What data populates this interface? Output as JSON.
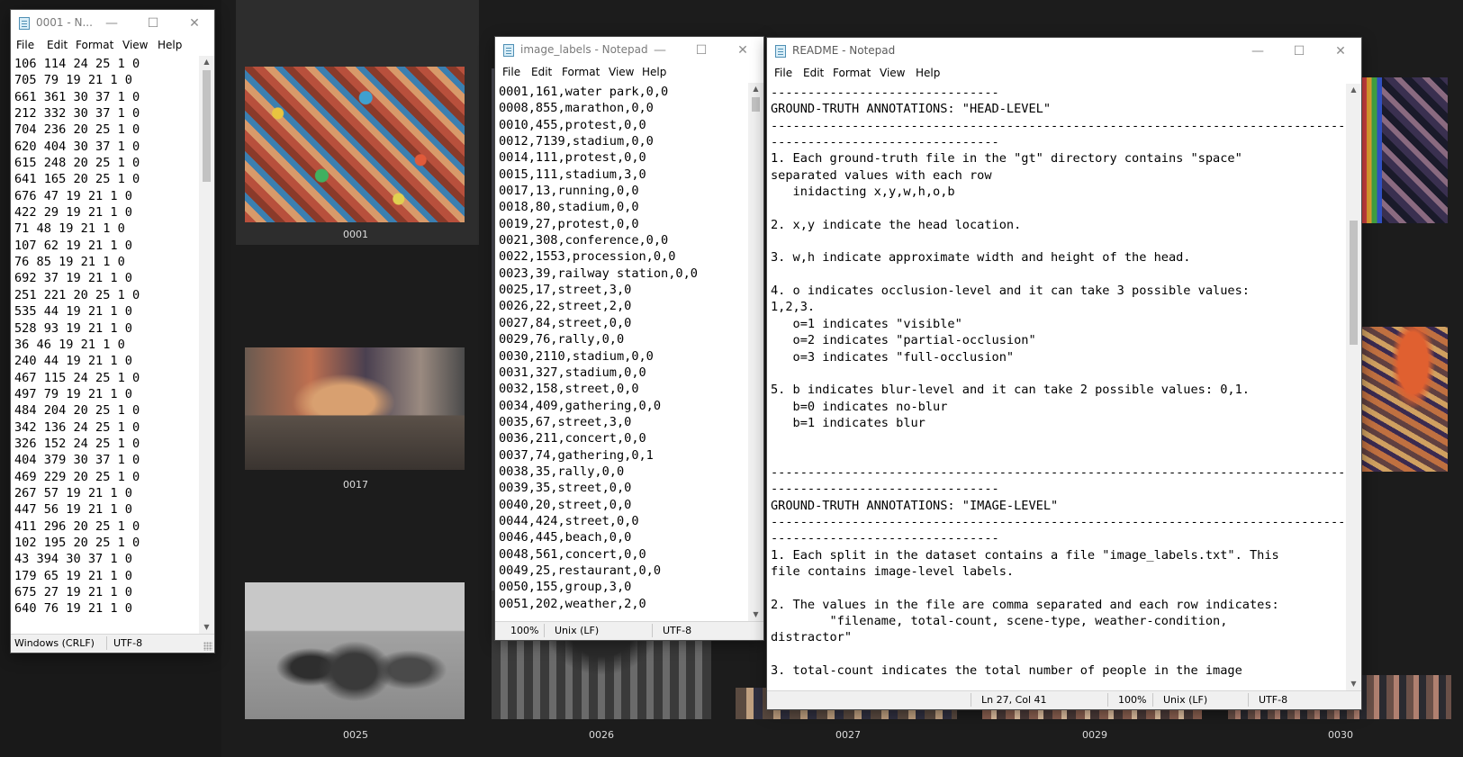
{
  "gallery": {
    "captions": [
      "0001",
      "0017",
      "0025",
      "0026",
      "0027",
      "0029",
      "0030"
    ]
  },
  "colors": {
    "desktop_bg": "#1c1c1c",
    "selected_thumb_bg": "#2d2d2d",
    "window_bg": "#ffffff",
    "statusbar_bg": "#f0f0f0"
  },
  "windows": {
    "gt_file": {
      "title": "0001 - N...",
      "menu": [
        "File",
        "Edit",
        "Format",
        "View",
        "Help"
      ],
      "lines": [
        "106 114 24 25 1 0",
        "705 79 19 21 1 0",
        "661 361 30 37 1 0",
        "212 332 30 37 1 0",
        "704 236 20 25 1 0",
        "620 404 30 37 1 0",
        "615 248 20 25 1 0",
        "641 165 20 25 1 0",
        "676 47 19 21 1 0",
        "422 29 19 21 1 0",
        "71 48 19 21 1 0",
        "107 62 19 21 1 0",
        "76 85 19 21 1 0",
        "692 37 19 21 1 0",
        "251 221 20 25 1 0",
        "535 44 19 21 1 0",
        "528 93 19 21 1 0",
        "36 46 19 21 1 0",
        "240 44 19 21 1 0",
        "467 115 24 25 1 0",
        "497 79 19 21 1 0",
        "484 204 20 25 1 0",
        "342 136 24 25 1 0",
        "326 152 24 25 1 0",
        "404 379 30 37 1 0",
        "469 229 20 25 1 0",
        "267 57 19 21 1 0",
        "447 56 19 21 1 0",
        "411 296 20 25 1 0",
        "102 195 20 25 1 0",
        "43 394 30 37 1 0",
        "179 65 19 21 1 0",
        "675 27 19 21 1 0",
        "640 76 19 21 1 0"
      ],
      "status": {
        "line_ending": "Windows (CRLF)",
        "encoding": "UTF-8"
      }
    },
    "image_labels": {
      "title": "image_labels - Notepad",
      "menu": [
        "File",
        "Edit",
        "Format",
        "View",
        "Help"
      ],
      "lines": [
        "0001,161,water park,0,0",
        "0008,855,marathon,0,0",
        "0010,455,protest,0,0",
        "0012,7139,stadium,0,0",
        "0014,111,protest,0,0",
        "0015,111,stadium,3,0",
        "0017,13,running,0,0",
        "0018,80,stadium,0,0",
        "0019,27,protest,0,0",
        "0021,308,conference,0,0",
        "0022,1553,procession,0,0",
        "0023,39,railway station,0,0",
        "0025,17,street,3,0",
        "0026,22,street,2,0",
        "0027,84,street,0,0",
        "0029,76,rally,0,0",
        "0030,2110,stadium,0,0",
        "0031,327,stadium,0,0",
        "0032,158,street,0,0",
        "0034,409,gathering,0,0",
        "0035,67,street,3,0",
        "0036,211,concert,0,0",
        "0037,74,gathering,0,1",
        "0038,35,rally,0,0",
        "0039,35,street,0,0",
        "0040,20,street,0,0",
        "0044,424,street,0,0",
        "0046,445,beach,0,0",
        "0048,561,concert,0,0",
        "0049,25,restaurant,0,0",
        "0050,155,group,3,0",
        "0051,202,weather,2,0"
      ],
      "status": {
        "zoom": "100%",
        "line_ending": "Unix (LF)",
        "encoding": "UTF-8"
      }
    },
    "readme": {
      "title": "README - Notepad",
      "menu": [
        "File",
        "Edit",
        "Format",
        "View",
        "Help"
      ],
      "lines": [
        "-------------------------------",
        "GROUND-TRUTH ANNOTATIONS: \"HEAD-LEVEL\"",
        "-------------------------------------------------------------------------------",
        "-------------------------------",
        "1. Each ground-truth file in the \"gt\" directory contains \"space\"",
        "separated values with each row",
        "   inidacting x,y,w,h,o,b",
        "",
        "2. x,y indicate the head location.",
        "",
        "3. w,h indicate approximate width and height of the head.",
        "",
        "4. o indicates occlusion-level and it can take 3 possible values:",
        "1,2,3.",
        "   o=1 indicates \"visible\"",
        "   o=2 indicates \"partial-occlusion\"",
        "   o=3 indicates \"full-occlusion\"",
        "",
        "5. b indicates blur-level and it can take 2 possible values: 0,1.",
        "   b=0 indicates no-blur",
        "   b=1 indicates blur",
        "",
        "",
        "-------------------------------------------------------------------------------",
        "-------------------------------",
        "GROUND-TRUTH ANNOTATIONS: \"IMAGE-LEVEL\"",
        "-------------------------------------------------------------------------------",
        "-------------------------------",
        "1. Each split in the dataset contains a file \"image_labels.txt\". This",
        "file contains image-level labels.",
        "",
        "2. The values in the file are comma separated and each row indicates:",
        "        \"filename, total-count, scene-type, weather-condition,",
        "distractor\"",
        "",
        "3. total-count indicates the total number of people in the image"
      ],
      "status": {
        "position": "Ln 27, Col 41",
        "zoom": "100%",
        "line_ending": "Unix (LF)",
        "encoding": "UTF-8"
      }
    }
  }
}
